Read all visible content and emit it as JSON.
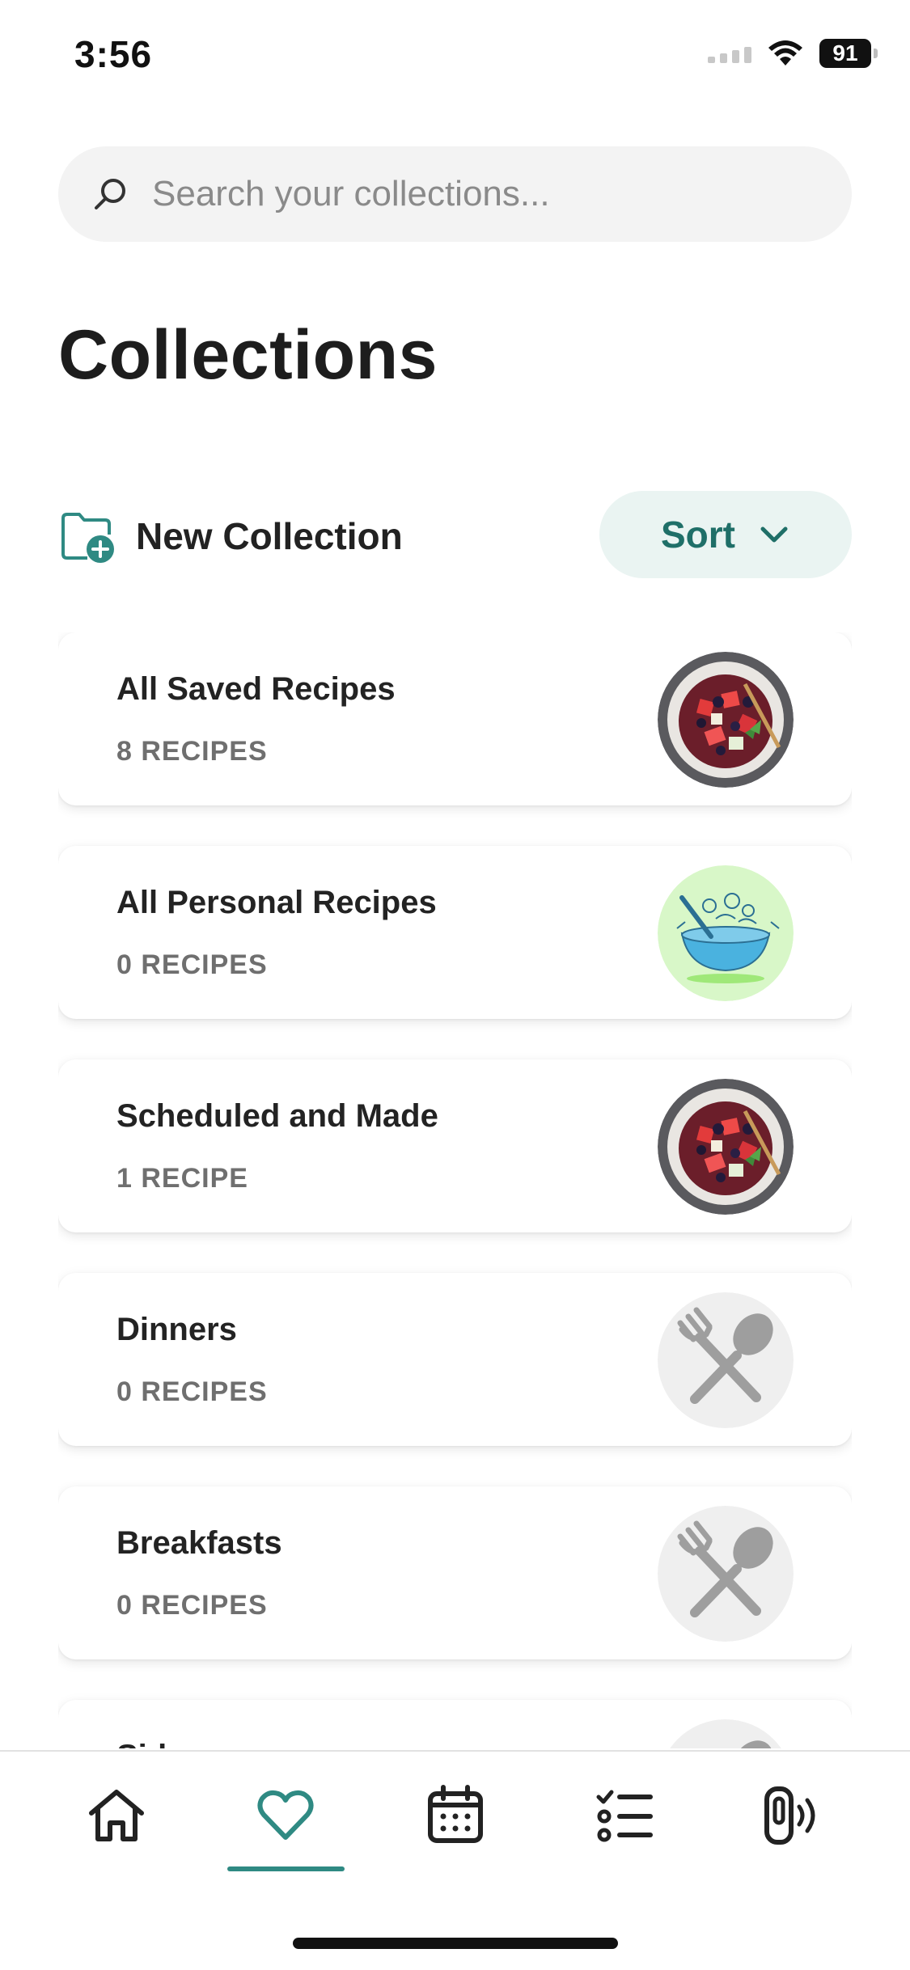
{
  "status_bar": {
    "time": "3:56",
    "battery": "91"
  },
  "search": {
    "placeholder": "Search your collections..."
  },
  "page": {
    "title": "Collections"
  },
  "actions": {
    "new_collection_label": "New Collection",
    "sort_label": "Sort"
  },
  "collections": [
    {
      "title": "All Saved Recipes",
      "count": "8 RECIPES",
      "thumb": "fruit-salad"
    },
    {
      "title": "All Personal Recipes",
      "count": "0 RECIPES",
      "thumb": "mixing-bowl-illustration"
    },
    {
      "title": "Scheduled and Made",
      "count": "1 RECIPE",
      "thumb": "fruit-salad"
    },
    {
      "title": "Dinners",
      "count": "0 RECIPES",
      "thumb": "fork-spoon-placeholder"
    },
    {
      "title": "Breakfasts",
      "count": "0 RECIPES",
      "thumb": "fork-spoon-placeholder"
    },
    {
      "title": "Sides",
      "count": "",
      "thumb": "fork-spoon-placeholder"
    }
  ],
  "tab_bar": {
    "items": [
      {
        "icon": "home-icon"
      },
      {
        "icon": "heart-icon",
        "active": true
      },
      {
        "icon": "calendar-icon"
      },
      {
        "icon": "checklist-icon"
      },
      {
        "icon": "connected-device-icon"
      }
    ]
  },
  "colors": {
    "accent": "#2f8a83",
    "sort_bg": "#eaf4f2",
    "search_bg": "#f3f3f3"
  }
}
